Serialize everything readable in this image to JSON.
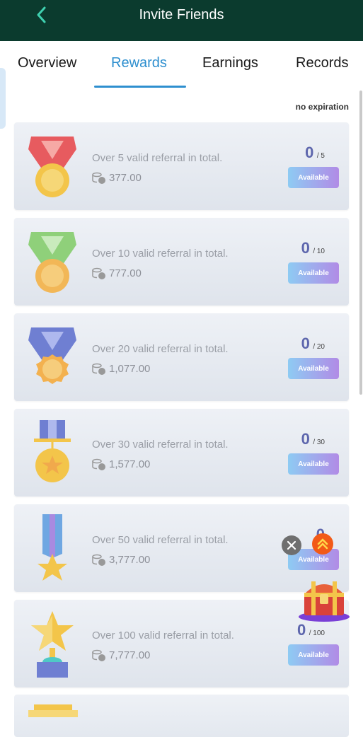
{
  "header": {
    "title": "Invite Friends",
    "back_icon": "chevron-left-icon"
  },
  "tabs": [
    {
      "label": "Overview",
      "active": false
    },
    {
      "label": "Rewards",
      "active": true
    },
    {
      "label": "Earnings",
      "active": false
    },
    {
      "label": "Records",
      "active": false
    }
  ],
  "expiry_note": "no expiration",
  "rewards": [
    {
      "title": "Over 5 valid referral in total.",
      "amount": "377.00",
      "current": "0",
      "total": "/ 5",
      "button": "Available",
      "medal": "red-ribbon-medal-icon"
    },
    {
      "title": "Over 10 valid referral in total.",
      "amount": "777.00",
      "current": "0",
      "total": "/ 10",
      "button": "Available",
      "medal": "green-ribbon-medal-icon"
    },
    {
      "title": "Over 20 valid referral in total.",
      "amount": "1,077.00",
      "current": "0",
      "total": "/ 20",
      "button": "Available",
      "medal": "blue-ribbon-medal-icon"
    },
    {
      "title": "Over 30 valid referral in total.",
      "amount": "1,577.00",
      "current": "0",
      "total": "/ 30",
      "button": "Available",
      "medal": "star-medal-icon"
    },
    {
      "title": "Over 50 valid referral in total.",
      "amount": "3,777.00",
      "current": "0",
      "total": "",
      "button": "Available",
      "medal": "star-ribbon-icon"
    },
    {
      "title": "Over 100 valid referral in total.",
      "amount": "7,777.00",
      "current": "0",
      "total": "/ 100",
      "button": "Available",
      "medal": "star-trophy-icon"
    }
  ],
  "floating": {
    "close_icon": "close-icon",
    "up_icon": "double-chevron-up-icon",
    "chest_icon": "treasure-chest-icon"
  },
  "colors": {
    "header_bg": "#0b3b2e",
    "tab_active": "#2e8fcf",
    "button_from": "#8ecbf3",
    "button_to": "#b18be6"
  }
}
